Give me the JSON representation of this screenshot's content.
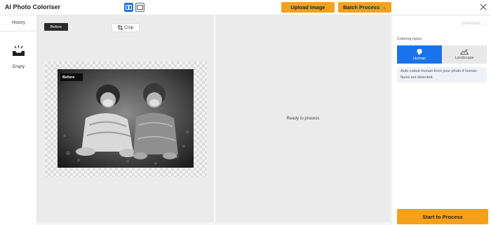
{
  "app": {
    "title": "AI Photo Coloriser"
  },
  "toolbar": {
    "upload_label": "Upload Image",
    "batch_label": "Batch Process →"
  },
  "sidebar": {
    "history_label": "History",
    "empty_label": "Empty"
  },
  "before_panel": {
    "before_tag": "Before",
    "crop_label": "Crop",
    "photo_tag": "Before"
  },
  "result_panel": {
    "status": "Ready to process"
  },
  "right_panel": {
    "download_label": "Download",
    "coloring_types_label": "Coloring types",
    "types": [
      {
        "label": "Human",
        "icon": "human-head-icon",
        "selected": true
      },
      {
        "label": "Landscape",
        "icon": "landscape-icon",
        "selected": false
      }
    ],
    "info_text": "Auto cutout human from your photo if human faces are detected.",
    "start_label": "Start to Process"
  },
  "colors": {
    "accent_orange": "#f5a11c",
    "accent_blue": "#1a73e8",
    "canvas_gray": "#ebebeb"
  }
}
